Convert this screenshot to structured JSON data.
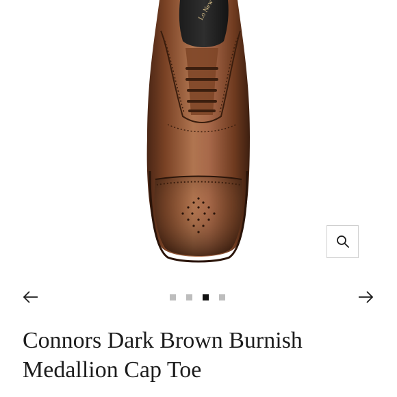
{
  "product": {
    "title_line1": "Connors Dark Brown Burnish",
    "title_line2": "Medallion Cap Toe",
    "insole_brand": "Lo New York"
  },
  "gallery": {
    "image_count": 4,
    "active_index": 3,
    "prev_icon": "arrow-left-icon",
    "next_icon": "arrow-right-icon",
    "zoom_icon": "magnifier-icon"
  },
  "colors": {
    "dot_active": "#111111",
    "dot_inactive": "#bdbdbd",
    "leather_base": "#8a4f2d",
    "leather_dark": "#4a2615"
  }
}
